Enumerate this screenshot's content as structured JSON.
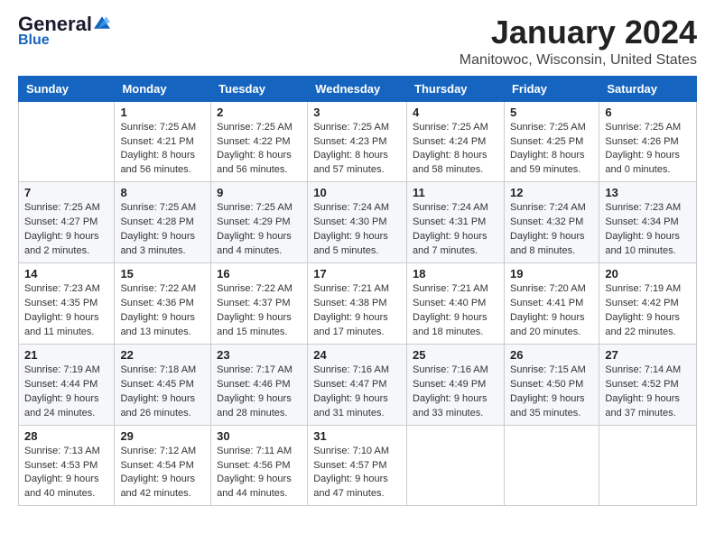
{
  "header": {
    "logo_general": "General",
    "logo_blue": "Blue",
    "month_title": "January 2024",
    "location": "Manitowoc, Wisconsin, United States"
  },
  "days_of_week": [
    "Sunday",
    "Monday",
    "Tuesday",
    "Wednesday",
    "Thursday",
    "Friday",
    "Saturday"
  ],
  "weeks": [
    [
      {
        "day": "",
        "info": ""
      },
      {
        "day": "1",
        "info": "Sunrise: 7:25 AM\nSunset: 4:21 PM\nDaylight: 8 hours\nand 56 minutes."
      },
      {
        "day": "2",
        "info": "Sunrise: 7:25 AM\nSunset: 4:22 PM\nDaylight: 8 hours\nand 56 minutes."
      },
      {
        "day": "3",
        "info": "Sunrise: 7:25 AM\nSunset: 4:23 PM\nDaylight: 8 hours\nand 57 minutes."
      },
      {
        "day": "4",
        "info": "Sunrise: 7:25 AM\nSunset: 4:24 PM\nDaylight: 8 hours\nand 58 minutes."
      },
      {
        "day": "5",
        "info": "Sunrise: 7:25 AM\nSunset: 4:25 PM\nDaylight: 8 hours\nand 59 minutes."
      },
      {
        "day": "6",
        "info": "Sunrise: 7:25 AM\nSunset: 4:26 PM\nDaylight: 9 hours\nand 0 minutes."
      }
    ],
    [
      {
        "day": "7",
        "info": "Sunrise: 7:25 AM\nSunset: 4:27 PM\nDaylight: 9 hours\nand 2 minutes."
      },
      {
        "day": "8",
        "info": "Sunrise: 7:25 AM\nSunset: 4:28 PM\nDaylight: 9 hours\nand 3 minutes."
      },
      {
        "day": "9",
        "info": "Sunrise: 7:25 AM\nSunset: 4:29 PM\nDaylight: 9 hours\nand 4 minutes."
      },
      {
        "day": "10",
        "info": "Sunrise: 7:24 AM\nSunset: 4:30 PM\nDaylight: 9 hours\nand 5 minutes."
      },
      {
        "day": "11",
        "info": "Sunrise: 7:24 AM\nSunset: 4:31 PM\nDaylight: 9 hours\nand 7 minutes."
      },
      {
        "day": "12",
        "info": "Sunrise: 7:24 AM\nSunset: 4:32 PM\nDaylight: 9 hours\nand 8 minutes."
      },
      {
        "day": "13",
        "info": "Sunrise: 7:23 AM\nSunset: 4:34 PM\nDaylight: 9 hours\nand 10 minutes."
      }
    ],
    [
      {
        "day": "14",
        "info": "Sunrise: 7:23 AM\nSunset: 4:35 PM\nDaylight: 9 hours\nand 11 minutes."
      },
      {
        "day": "15",
        "info": "Sunrise: 7:22 AM\nSunset: 4:36 PM\nDaylight: 9 hours\nand 13 minutes."
      },
      {
        "day": "16",
        "info": "Sunrise: 7:22 AM\nSunset: 4:37 PM\nDaylight: 9 hours\nand 15 minutes."
      },
      {
        "day": "17",
        "info": "Sunrise: 7:21 AM\nSunset: 4:38 PM\nDaylight: 9 hours\nand 17 minutes."
      },
      {
        "day": "18",
        "info": "Sunrise: 7:21 AM\nSunset: 4:40 PM\nDaylight: 9 hours\nand 18 minutes."
      },
      {
        "day": "19",
        "info": "Sunrise: 7:20 AM\nSunset: 4:41 PM\nDaylight: 9 hours\nand 20 minutes."
      },
      {
        "day": "20",
        "info": "Sunrise: 7:19 AM\nSunset: 4:42 PM\nDaylight: 9 hours\nand 22 minutes."
      }
    ],
    [
      {
        "day": "21",
        "info": "Sunrise: 7:19 AM\nSunset: 4:44 PM\nDaylight: 9 hours\nand 24 minutes."
      },
      {
        "day": "22",
        "info": "Sunrise: 7:18 AM\nSunset: 4:45 PM\nDaylight: 9 hours\nand 26 minutes."
      },
      {
        "day": "23",
        "info": "Sunrise: 7:17 AM\nSunset: 4:46 PM\nDaylight: 9 hours\nand 28 minutes."
      },
      {
        "day": "24",
        "info": "Sunrise: 7:16 AM\nSunset: 4:47 PM\nDaylight: 9 hours\nand 31 minutes."
      },
      {
        "day": "25",
        "info": "Sunrise: 7:16 AM\nSunset: 4:49 PM\nDaylight: 9 hours\nand 33 minutes."
      },
      {
        "day": "26",
        "info": "Sunrise: 7:15 AM\nSunset: 4:50 PM\nDaylight: 9 hours\nand 35 minutes."
      },
      {
        "day": "27",
        "info": "Sunrise: 7:14 AM\nSunset: 4:52 PM\nDaylight: 9 hours\nand 37 minutes."
      }
    ],
    [
      {
        "day": "28",
        "info": "Sunrise: 7:13 AM\nSunset: 4:53 PM\nDaylight: 9 hours\nand 40 minutes."
      },
      {
        "day": "29",
        "info": "Sunrise: 7:12 AM\nSunset: 4:54 PM\nDaylight: 9 hours\nand 42 minutes."
      },
      {
        "day": "30",
        "info": "Sunrise: 7:11 AM\nSunset: 4:56 PM\nDaylight: 9 hours\nand 44 minutes."
      },
      {
        "day": "31",
        "info": "Sunrise: 7:10 AM\nSunset: 4:57 PM\nDaylight: 9 hours\nand 47 minutes."
      },
      {
        "day": "",
        "info": ""
      },
      {
        "day": "",
        "info": ""
      },
      {
        "day": "",
        "info": ""
      }
    ]
  ]
}
